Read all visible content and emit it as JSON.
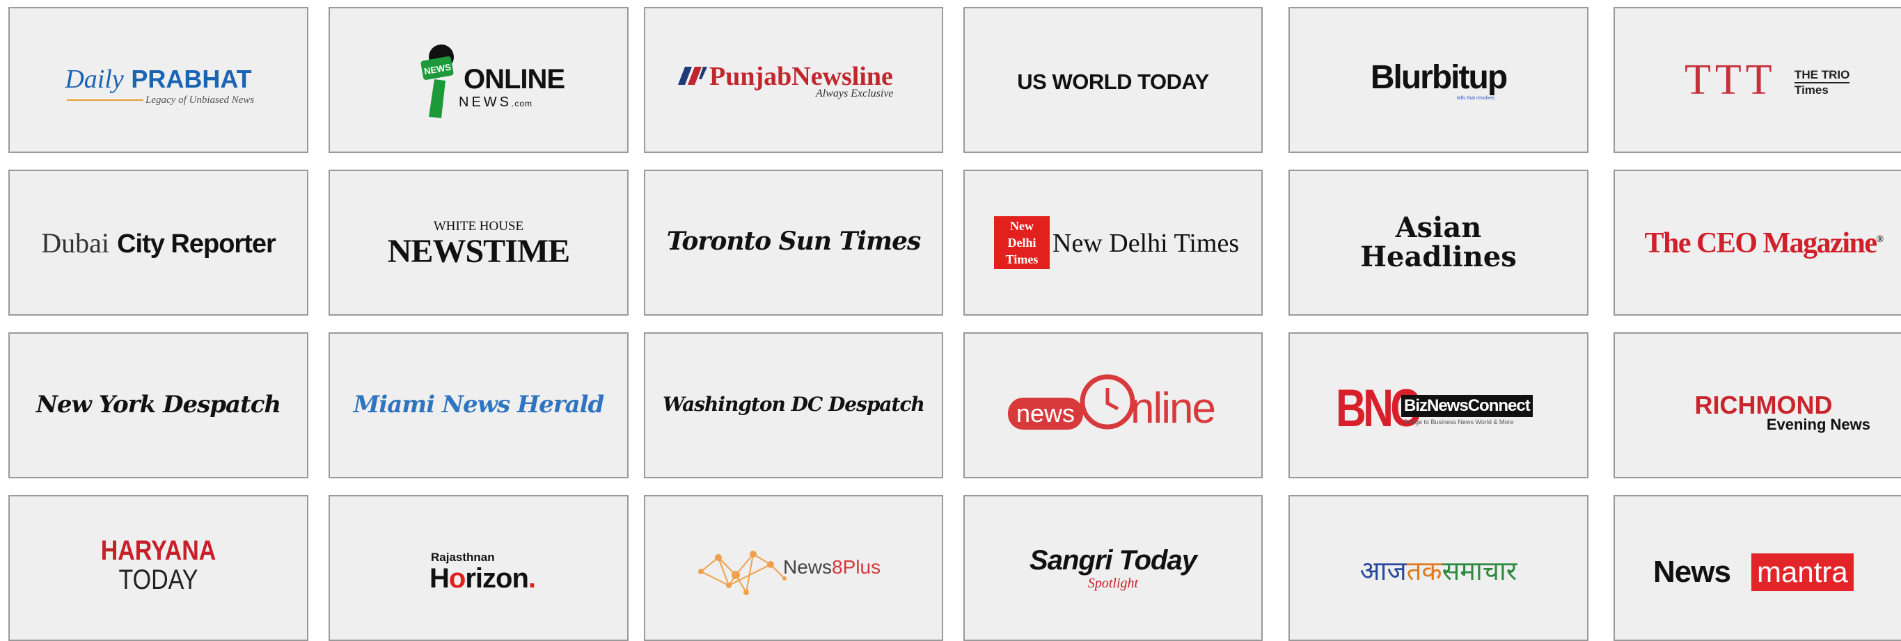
{
  "logos": {
    "daily_prabhat": {
      "name_a": "Daily",
      "name_b": "PRABHAT",
      "tagline": "Legacy of Unbiased News"
    },
    "online_news": {
      "badge": "NEWS",
      "name": "ONLINE",
      "sub": "NEWS",
      "domain": ".com"
    },
    "punjab_newsline": {
      "name": "PunjabNewsline",
      "tagline": "Always Exclusive"
    },
    "us_world_today": {
      "name": "US WORLD TODAY"
    },
    "blurbitup": {
      "name": "Blurbitup",
      "tagline": "tells that resolves"
    },
    "ttt": {
      "mark": "TTT",
      "line1": "THE TRIO",
      "line2": "Times"
    },
    "dubai_city_reporter": {
      "name_a": "Dubai",
      "name_b": "City Reporter"
    },
    "white_house_newstime": {
      "top": "WHITE HOUSE",
      "name": "NEWSTIME"
    },
    "toronto_sun_times": {
      "name": "Toronto Sun Times"
    },
    "new_delhi_times": {
      "box1": "New",
      "box2": "Delhi",
      "box3": "Times",
      "name": "New Delhi Times"
    },
    "asian_headlines": {
      "line1": "Asian",
      "line2": "Headlines"
    },
    "ceo_magazine": {
      "name": "The CEO Magazine",
      "reg": "®"
    },
    "new_york_despatch": {
      "name": "New York Despatch"
    },
    "miami_news_herald": {
      "name": "Miami News Herald"
    },
    "washington_dc_despatch": {
      "name": "Washington DC Despatch"
    },
    "news_online": {
      "a": "news",
      "b": "nline"
    },
    "bnc": {
      "mark": "BNC",
      "name": "BizNewsConnect",
      "tagline": "Bridge to Business News World & More"
    },
    "richmond": {
      "line1": "RICHMOND",
      "line2": "Evening News"
    },
    "haryana_today": {
      "line1": "HARYANA",
      "line2": "TODAY"
    },
    "rajasthan_horizon": {
      "top": "Rajasthnan",
      "h": "H",
      "o": "o",
      "rest": "rizon",
      "dot": "."
    },
    "news8plus": {
      "a": "News",
      "b": "8",
      "c": "Plus"
    },
    "sangri_today": {
      "name": "Sangri Today",
      "tagline": "Spotlight"
    },
    "aaj_tak_samachar": {
      "a": "आज",
      "b": "तक",
      "c": "समाचार"
    },
    "news_mantra": {
      "a": "News",
      "b": "mantra"
    }
  },
  "colors": {
    "card_bg": "#efefef",
    "card_border": "#9a9a9a",
    "prabhat_blue": "#1b64b4",
    "online_green": "#1c9a3a",
    "punjab_red": "#c0272d",
    "ttt_red": "#c6303a",
    "ceo_red": "#d0202a",
    "ndt_red": "#e2201d",
    "miami_blue": "#2e74c0",
    "newsonline_red": "#d83a3c",
    "bnc_red": "#d91f2a",
    "richmond_red": "#c9252c",
    "haryana_red": "#c8202a",
    "news8_red": "#d33a3a",
    "news8_orange": "#f0a04a",
    "sangri_red": "#c8202a",
    "aaj_blue": "#274a9c",
    "aaj_orange": "#e07a1c",
    "aaj_green": "#2e8a3e",
    "mantra_red": "#e3252a"
  }
}
